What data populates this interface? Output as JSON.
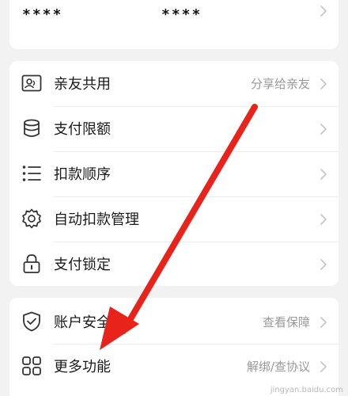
{
  "top_card": {
    "masked_left": "****",
    "masked_right": "****"
  },
  "settings": {
    "items": [
      {
        "label": "亲友共用",
        "right_text": "分享给亲友",
        "icon": "contact-card-icon"
      },
      {
        "label": "支付限额",
        "right_text": "",
        "icon": "database-stack-icon"
      },
      {
        "label": "扣款顺序",
        "right_text": "",
        "icon": "list-icon"
      },
      {
        "label": "自动扣款管理",
        "right_text": "",
        "icon": "gear-icon"
      },
      {
        "label": "支付锁定",
        "right_text": "",
        "icon": "lock-icon"
      }
    ]
  },
  "security": {
    "items": [
      {
        "label": "账户安全险",
        "right_text": "查看保障",
        "icon": "shield-check-icon"
      },
      {
        "label": "更多功能",
        "right_text": "解绑/查协议",
        "icon": "grid-icon"
      }
    ]
  },
  "annotation": {
    "arrow_color": "#e8231b"
  },
  "watermark": "jingyan.baidu.com"
}
